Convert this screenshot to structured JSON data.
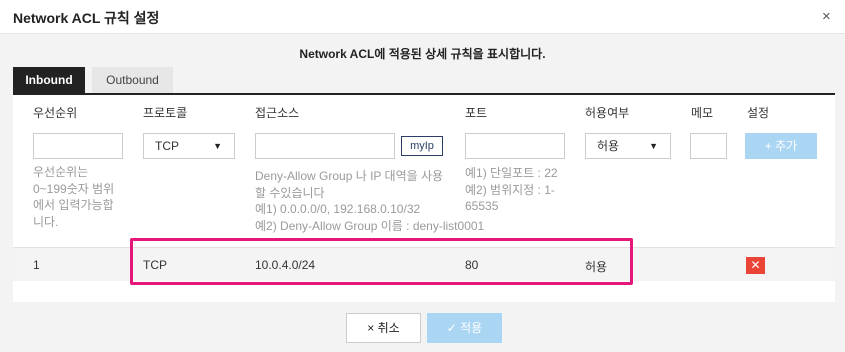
{
  "dialog": {
    "title": "Network ACL 규칙 설정",
    "close_icon": "×"
  },
  "description": "Network ACL에 적용된 상세 규칙을 표시합니다.",
  "tabs": [
    {
      "label": "Inbound",
      "active": true
    },
    {
      "label": "Outbound",
      "active": false
    }
  ],
  "columns": {
    "priority": "우선순위",
    "protocol": "프로토콜",
    "source": "접근소스",
    "port": "포트",
    "allow": "허용여부",
    "memo": "메모",
    "settings": "설정"
  },
  "form": {
    "protocol_value": "TCP",
    "myip_label": "myIp",
    "allow_value": "허용",
    "add_label": "+ 추가",
    "priority_help": [
      "우선순위는",
      "0~199숫자 범위",
      "에서 입력가능합",
      "니다."
    ],
    "source_help": [
      "Deny-Allow Group 나 IP 대역을 사용",
      "할 수있습니다",
      "예1) 0.0.0.0/0, 192.168.0.10/32",
      "예2) Deny-Allow Group 이름 : deny-list0001"
    ],
    "port_help": [
      "예1) 단일포트 : 22",
      "예2) 범위지정 : 1-",
      "65535"
    ]
  },
  "rules": [
    {
      "priority": "1",
      "protocol": "TCP",
      "source": "10.0.4.0/24",
      "port": "80",
      "allow": "허용",
      "delete_icon": "✕"
    }
  ],
  "footer": {
    "cancel_label": "× 취소",
    "apply_label": "✓ 적용"
  },
  "colors": {
    "accent": "#aad5f3",
    "highlight": "#e5177b",
    "delete": "#e94436"
  }
}
